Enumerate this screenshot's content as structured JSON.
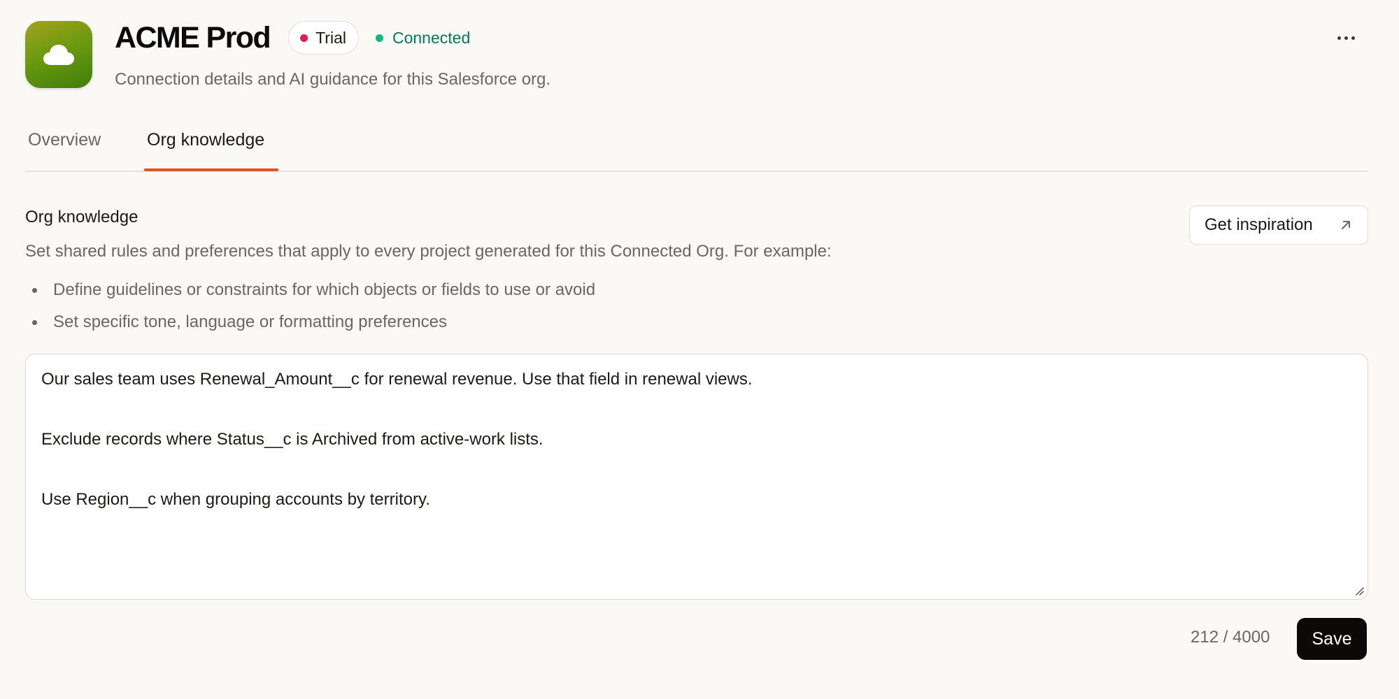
{
  "header": {
    "app_icon": "cloud-icon",
    "title": "ACME Prod",
    "badge": {
      "label": "Trial",
      "dot_color": "#e11d48"
    },
    "status": {
      "label": "Connected",
      "color": "#047857",
      "dot_color": "#10b981"
    },
    "subtitle": "Connection details and AI guidance for this Salesforce org.",
    "more_icon": "more-horizontal-icon"
  },
  "tabs": [
    {
      "label": "Overview",
      "active": false
    },
    {
      "label": "Org knowledge",
      "active": true
    }
  ],
  "accent_color": "#e0531f",
  "section": {
    "title": "Org knowledge",
    "description": "Set shared rules and preferences that apply to every project generated for this Connected Org. For example:",
    "bullets": [
      "Define guidelines or constraints for which objects or fields to use or avoid",
      "Set specific tone, language or formatting preferences"
    ],
    "inspiration_button": {
      "label": "Get inspiration",
      "icon": "arrow-up-right-icon"
    }
  },
  "editor": {
    "lines": [
      "Our sales team uses Renewal_Amount__c for renewal revenue. Use that field in renewal views.",
      "",
      "Exclude records where Status__c is Archived from active-work lists.",
      "",
      "Use Region__c when grouping accounts by territory."
    ]
  },
  "footer": {
    "char_count": "212 / 4000",
    "save_label": "Save"
  }
}
